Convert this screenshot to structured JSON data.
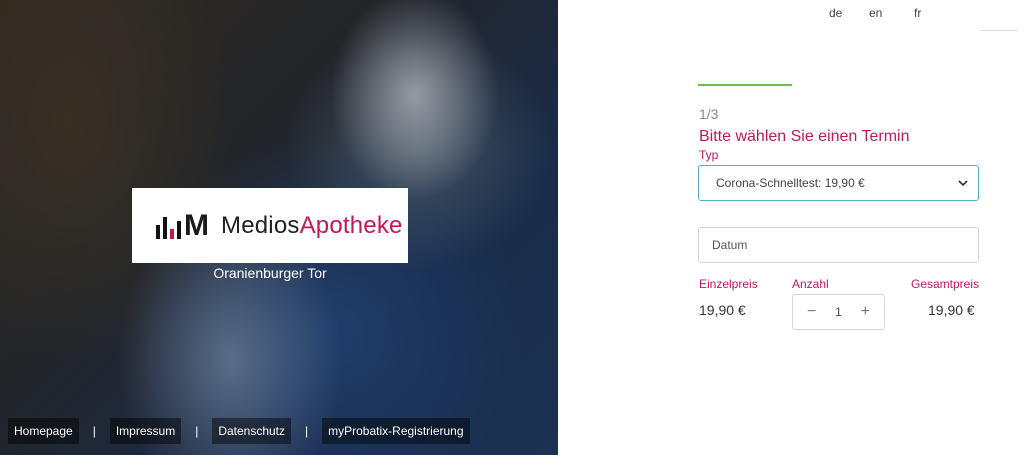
{
  "brand": {
    "name_part1": "Medios",
    "name_part2": "Apotheke",
    "mark_letter": "M",
    "location": "Oranienburger Tor",
    "accent_color": "#c2185b"
  },
  "footer": {
    "links": [
      "Homepage",
      "Impressum",
      "Datenschutz",
      "myProbatix-Registrierung"
    ],
    "separator": "|"
  },
  "language": {
    "options": [
      "de",
      "en",
      "fr"
    ]
  },
  "form": {
    "progress_color": "#6cc04a",
    "step": "1/3",
    "heading": "Bitte wählen Sie einen Termin",
    "type_label": "Typ",
    "type_selected": "Corona-Schnelltest: 19,90 €",
    "date_placeholder": "Datum",
    "unit_price_label": "Einzelpreis",
    "unit_price": "19,90 €",
    "quantity_label": "Anzahl",
    "quantity": "1",
    "total_label": "Gesamtpreis",
    "total_price": "19,90 €",
    "minus_symbol": "−",
    "plus_symbol": "+"
  }
}
